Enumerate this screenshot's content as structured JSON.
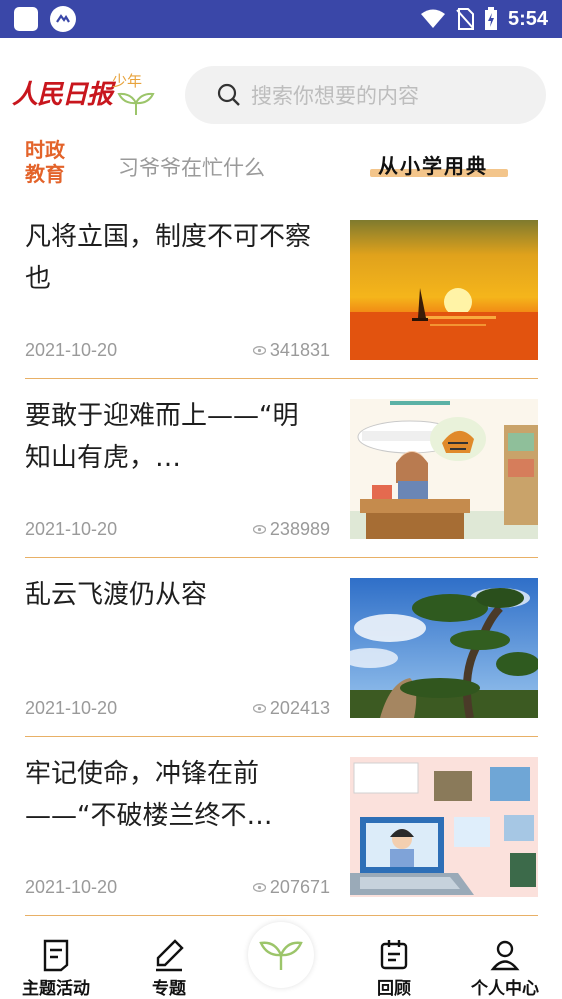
{
  "status_bar": {
    "time": "5:54",
    "icons": [
      "app-square-icon",
      "link-circle-icon",
      "wifi-icon",
      "no-sim-icon",
      "battery-charging-icon"
    ]
  },
  "header": {
    "logo_text": "人民日报",
    "logo_sub": "少年",
    "search_placeholder": "搜索你想要的内容"
  },
  "tabs": [
    {
      "label": "时政\n教育",
      "active": true
    },
    {
      "label": "习爷爷在忙什么",
      "active": false
    },
    {
      "label": "从小学用典",
      "active": false
    }
  ],
  "articles": [
    {
      "title": "凡将立国，制度不可不察也",
      "date": "2021-10-20",
      "views": "341831",
      "thumb": "sunset-sea-image"
    },
    {
      "title": "要敢于迎难而上——“明知山有虎，…",
      "date": "2021-10-20",
      "views": "238989",
      "thumb": "teacher-tiger-illustration"
    },
    {
      "title": "乱云飞渡仍从容",
      "date": "2021-10-20",
      "views": "202413",
      "thumb": "pine-tree-image"
    },
    {
      "title": "牢记使命，冲锋在前——“不破楼兰终不…",
      "date": "2021-10-20",
      "views": "207671",
      "thumb": "laptop-teacher-illustration"
    }
  ],
  "bottom_nav": [
    {
      "label": "主题活动",
      "icon": "document-icon"
    },
    {
      "label": "专题",
      "icon": "pen-icon"
    },
    {
      "label": "",
      "icon": "sprout-icon"
    },
    {
      "label": "回顾",
      "icon": "calendar-icon"
    },
    {
      "label": "个人中心",
      "icon": "person-icon"
    }
  ],
  "colors": {
    "status_bar": "#3a47a8",
    "accent_orange": "#e3632a",
    "divider": "#e8b066",
    "logo_red": "#c8161d"
  }
}
